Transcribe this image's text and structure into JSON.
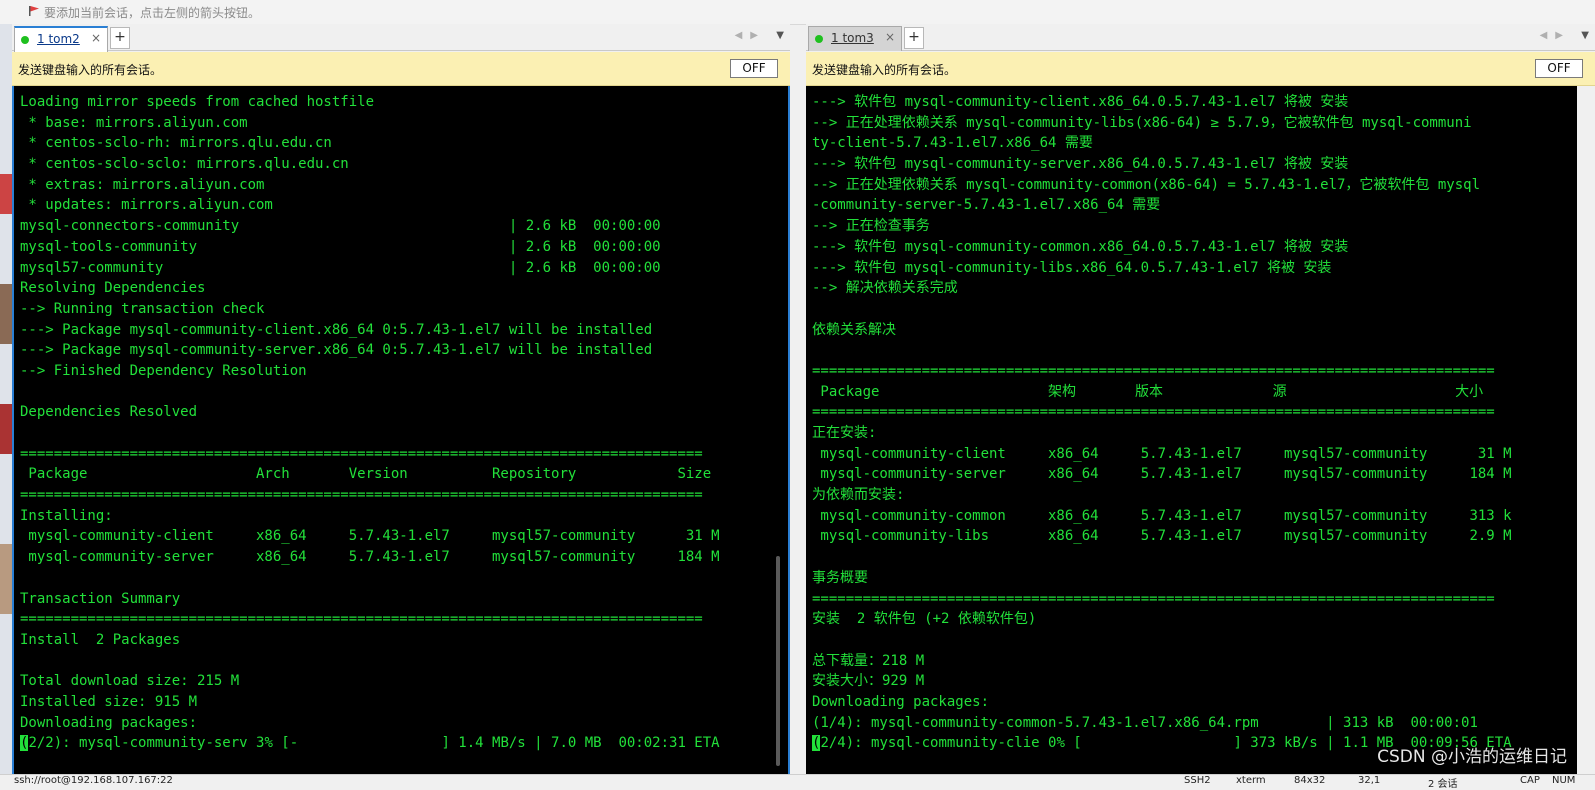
{
  "hint_bar": {
    "text": "要添加当前会话，点击左侧的箭头按钮。"
  },
  "left_pane": {
    "tab": {
      "label": "1 tom2",
      "close": "×",
      "add": "+"
    },
    "broadcast": {
      "message": "发送键盘输入的所有会话。",
      "toggle": "OFF"
    },
    "terminal": {
      "lines": [
        "Loading mirror speeds from cached hostfile",
        " * base: mirrors.aliyun.com",
        " * centos-sclo-rh: mirrors.qlu.edu.cn",
        " * centos-sclo-sclo: mirrors.qlu.edu.cn",
        " * extras: mirrors.aliyun.com",
        " * updates: mirrors.aliyun.com",
        "mysql-connectors-community                                | 2.6 kB  00:00:00",
        "mysql-tools-community                                     | 2.6 kB  00:00:00",
        "mysql57-community                                         | 2.6 kB  00:00:00",
        "Resolving Dependencies",
        "--> Running transaction check",
        "---> Package mysql-community-client.x86_64 0:5.7.43-1.el7 will be installed",
        "---> Package mysql-community-server.x86_64 0:5.7.43-1.el7 will be installed",
        "--> Finished Dependency Resolution",
        "",
        "Dependencies Resolved",
        "",
        "=================================================================================",
        " Package                    Arch       Version          Repository            Size",
        "=================================================================================",
        "Installing:",
        " mysql-community-client     x86_64     5.7.43-1.el7     mysql57-community      31 M",
        " mysql-community-server     x86_64     5.7.43-1.el7     mysql57-community     184 M",
        "",
        "Transaction Summary",
        "=================================================================================",
        "Install  2 Packages",
        "",
        "Total download size: 215 M",
        "Installed size: 915 M",
        "Downloading packages:"
      ],
      "last_line_cursor": "(",
      "last_line_rest": "2/2): mysql-community-serv 3% [-                 ] 1.4 MB/s | 7.0 MB  00:02:31 ETA"
    }
  },
  "right_pane": {
    "tab": {
      "label": "1 tom3",
      "close": "×",
      "add": "+"
    },
    "broadcast": {
      "message": "发送键盘输入的所有会话。",
      "toggle": "OFF"
    },
    "terminal": {
      "lines": [
        "---> 软件包 mysql-community-client.x86_64.0.5.7.43-1.el7 将被 安装",
        "--> 正在处理依赖关系 mysql-community-libs(x86-64) ≥ 5.7.9，它被软件包 mysql-communi",
        "ty-client-5.7.43-1.el7.x86_64 需要",
        "---> 软件包 mysql-community-server.x86_64.0.5.7.43-1.el7 将被 安装",
        "--> 正在处理依赖关系 mysql-community-common(x86-64) = 5.7.43-1.el7，它被软件包 mysql",
        "-community-server-5.7.43-1.el7.x86_64 需要",
        "--> 正在检查事务",
        "---> 软件包 mysql-community-common.x86_64.0.5.7.43-1.el7 将被 安装",
        "---> 软件包 mysql-community-libs.x86_64.0.5.7.43-1.el7 将被 安装",
        "--> 解决依赖关系完成",
        "",
        "依赖关系解决",
        "",
        "=================================================================================",
        " Package                    架构       版本             源                    大小",
        "=================================================================================",
        "正在安装:",
        " mysql-community-client     x86_64     5.7.43-1.el7     mysql57-community      31 M",
        " mysql-community-server     x86_64     5.7.43-1.el7     mysql57-community     184 M",
        "为依赖而安装:",
        " mysql-community-common     x86_64     5.7.43-1.el7     mysql57-community     313 k",
        " mysql-community-libs       x86_64     5.7.43-1.el7     mysql57-community     2.9 M",
        "",
        "事务概要",
        "=================================================================================",
        "安装  2 软件包 (+2 依赖软件包)",
        "",
        "总下载量：218 M",
        "安装大小：929 M",
        "Downloading packages:",
        "(1/4): mysql-community-common-5.7.43-1.el7.x86_64.rpm        | 313 kB  00:00:01"
      ],
      "last_line_cursor": "(",
      "last_line_rest": "2/4): mysql-community-clie 0% [                  ] 373 kB/s | 1.1 MB  00:09:56 ETA"
    }
  },
  "status_bar": {
    "connection": "ssh://root@192.168.107.167:22",
    "protocol": "SSH2",
    "term": "xterm",
    "size": "84x32",
    "pos": "32,1",
    "sessions": "2 会话",
    "cap": "CAP",
    "num": "NUM"
  },
  "watermark": "CSDN @小浩的运维日记",
  "colors": {
    "terminal_text": "#22e03a",
    "terminal_bg": "#000000",
    "broadcast_bg": "#fbf0b3",
    "active_tab": "#2a7fd4"
  }
}
